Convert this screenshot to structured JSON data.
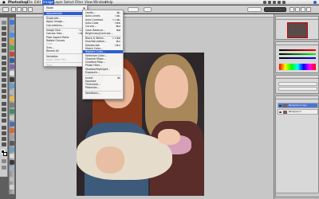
{
  "menubar": {
    "apple": "",
    "app_name": "Photoshop",
    "items": [
      "File",
      "Edit",
      "Image",
      "Layer",
      "Select",
      "Filter",
      "View",
      "Window",
      "Help"
    ],
    "active": "Image",
    "clock": ""
  },
  "image_menu": {
    "items": [
      {
        "label": "Mode",
        "arrow": "▶"
      },
      {
        "label": "Adjustments",
        "arrow": "▶",
        "highlighted": true
      },
      {
        "label": "Duplicate..."
      },
      {
        "label": "Apply Image..."
      },
      {
        "label": "Calculations..."
      },
      {
        "label": "Image Size...",
        "shortcut": "⌥⌘I"
      },
      {
        "label": "Canvas Size...",
        "shortcut": "⌥⌘C"
      },
      {
        "label": "Pixel Aspect Ratio",
        "arrow": "▶"
      },
      {
        "label": "Rotate Canvas",
        "arrow": "▶"
      },
      {
        "label": "Crop",
        "disabled": true
      },
      {
        "label": "Trim..."
      },
      {
        "label": "Reveal All"
      },
      {
        "label": "Variables",
        "arrow": "▶"
      },
      {
        "label": "Apply Data Set...",
        "disabled": true
      },
      {
        "label": "Trap...",
        "disabled": true
      }
    ]
  },
  "adjustments_menu": {
    "items": [
      {
        "label": "Levels...",
        "shortcut": "⌘L"
      },
      {
        "label": "Auto Levels",
        "shortcut": "⇧⌘L"
      },
      {
        "label": "Auto Contrast",
        "shortcut": "⌥⇧⌘L"
      },
      {
        "label": "Auto Color",
        "shortcut": "⇧⌘B"
      },
      {
        "label": "Curves...",
        "shortcut": "⌘M"
      },
      {
        "label": "Color Balance...",
        "shortcut": "⌘B"
      },
      {
        "label": "Brightness/Contrast..."
      },
      {
        "label": "Black & White...",
        "shortcut": "⌥⇧⌘B"
      },
      {
        "label": "Hue/Saturation...",
        "shortcut": "⌘U"
      },
      {
        "label": "Desaturate",
        "shortcut": "⇧⌘U"
      },
      {
        "label": "Match Color..."
      },
      {
        "label": "Replace Color...",
        "highlighted": true
      },
      {
        "label": "Selective Color..."
      },
      {
        "label": "Channel Mixer..."
      },
      {
        "label": "Gradient Map..."
      },
      {
        "label": "Photo Filter..."
      },
      {
        "label": "Shadow/Highlight..."
      },
      {
        "label": "Exposure..."
      },
      {
        "label": "Invert",
        "shortcut": "⌘I"
      },
      {
        "label": "Equalize"
      },
      {
        "label": "Threshold..."
      },
      {
        "label": "Posterize..."
      },
      {
        "label": "Variations..."
      }
    ]
  },
  "layers_panel": {
    "layers": [
      {
        "name": "Background copy",
        "selected": true
      },
      {
        "name": "Background",
        "selected": false
      }
    ]
  },
  "colors": {
    "highlight": "#2d5fd1",
    "menubar_bg": "#e6e6e6",
    "canvas_bg": "#c7c7c7"
  }
}
